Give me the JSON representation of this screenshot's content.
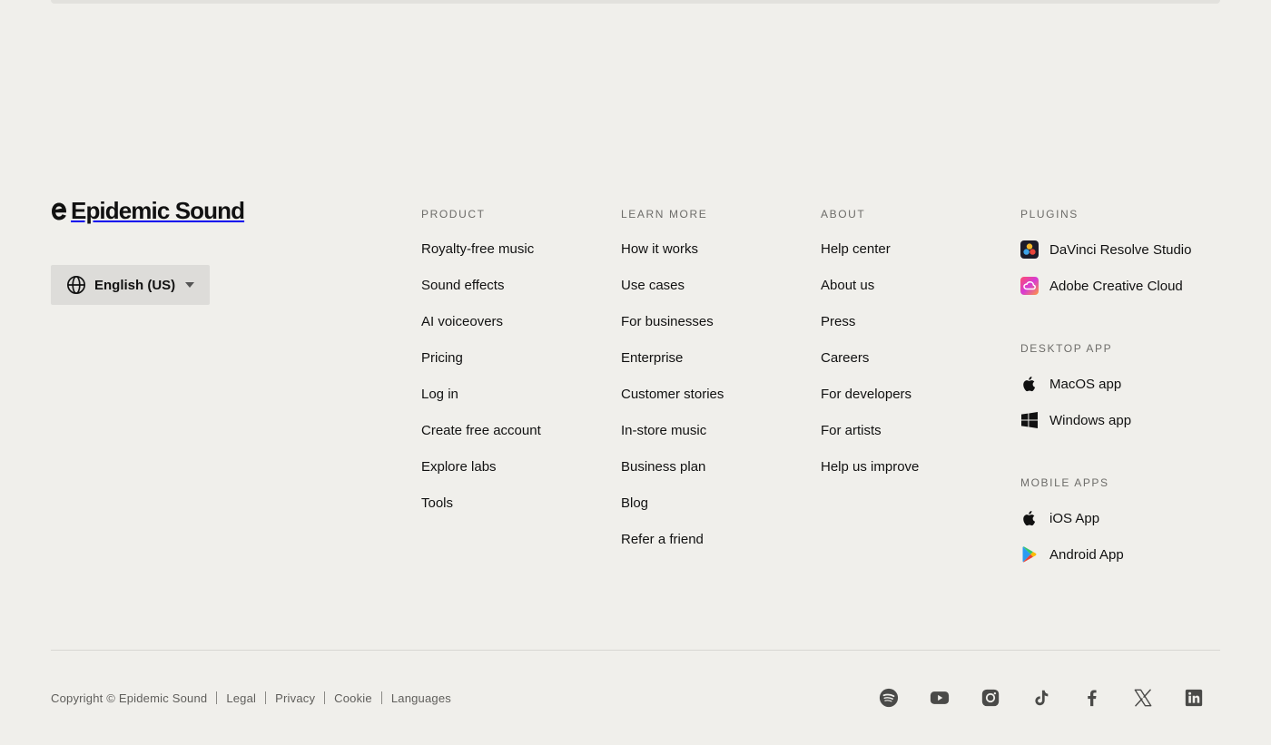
{
  "brand": {
    "name": "Epidemic Sound"
  },
  "language": {
    "label": "English (US)"
  },
  "columns": {
    "product": {
      "heading": "PRODUCT",
      "links": [
        "Royalty-free music",
        "Sound effects",
        "AI voiceovers",
        "Pricing",
        "Log in",
        "Create free account",
        "Explore labs",
        "Tools"
      ]
    },
    "learn": {
      "heading": "LEARN MORE",
      "links": [
        "How it works",
        "Use cases",
        "For businesses",
        "Enterprise",
        "Customer stories",
        "In-store music",
        "Business plan",
        "Blog",
        "Refer a friend"
      ]
    },
    "about": {
      "heading": "ABOUT",
      "links": [
        "Help center",
        "About us",
        "Press",
        "Careers",
        "For developers",
        "For artists",
        "Help us improve"
      ]
    },
    "plugins": {
      "heading": "PLUGINS",
      "items": [
        {
          "label": "DaVinci Resolve Studio",
          "icon": "davinci-icon"
        },
        {
          "label": "Adobe Creative Cloud",
          "icon": "adobe-cc-icon"
        }
      ]
    },
    "desktop": {
      "heading": "DESKTOP APP",
      "items": [
        {
          "label": "MacOS app",
          "icon": "apple-icon"
        },
        {
          "label": "Windows app",
          "icon": "windows-icon"
        }
      ]
    },
    "mobile": {
      "heading": "MOBILE APPS",
      "items": [
        {
          "label": "iOS App",
          "icon": "apple-icon"
        },
        {
          "label": "Android App",
          "icon": "google-play-icon"
        }
      ]
    }
  },
  "bottom": {
    "copyright": "Copyright © Epidemic Sound",
    "links": [
      "Legal",
      "Privacy",
      "Cookie",
      "Languages"
    ]
  },
  "socials": [
    "spotify-icon",
    "youtube-icon",
    "instagram-icon",
    "tiktok-icon",
    "facebook-icon",
    "x-icon",
    "linkedin-icon"
  ],
  "colors": {
    "background": "#f0efeb",
    "text": "#111111",
    "muted": "#6d6c69",
    "button": "#dddcd9"
  }
}
